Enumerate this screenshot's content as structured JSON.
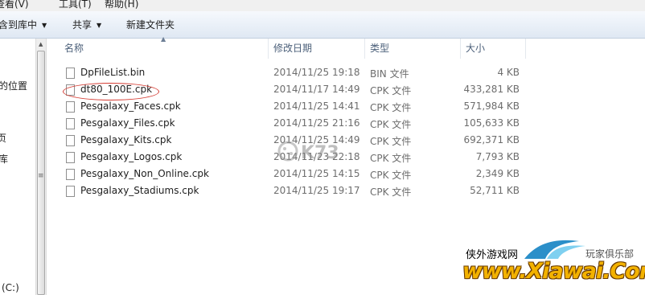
{
  "menu": [
    "查看(V)",
    "工具(T)",
    "帮助(H)"
  ],
  "toolbar": {
    "include_library": "含到库中",
    "share": "共享",
    "new_folder": "新建文件夹"
  },
  "nav": {
    "items": [
      "的位置",
      "页",
      "库"
    ],
    "drive": "(C:)"
  },
  "columns": {
    "name": "名称",
    "date": "修改日期",
    "type": "类型",
    "size": "大小"
  },
  "files": [
    {
      "name": "DpFileList.bin",
      "date": "2014/11/25 19:18",
      "type": "BIN 文件",
      "size": "4 KB"
    },
    {
      "name": "dt80_100E.cpk",
      "date": "2014/11/17 14:49",
      "type": "CPK 文件",
      "size": "433,281 KB"
    },
    {
      "name": "Pesgalaxy_Faces.cpk",
      "date": "2014/11/25 14:41",
      "type": "CPK 文件",
      "size": "571,984 KB"
    },
    {
      "name": "Pesgalaxy_Files.cpk",
      "date": "2014/11/25 21:16",
      "type": "CPK 文件",
      "size": "105,633 KB"
    },
    {
      "name": "Pesgalaxy_Kits.cpk",
      "date": "2014/11/25 14:49",
      "type": "CPK 文件",
      "size": "692,371 KB"
    },
    {
      "name": "Pesgalaxy_Logos.cpk",
      "date": "2014/11/23 22:18",
      "type": "CPK 文件",
      "size": "7,793 KB"
    },
    {
      "name": "Pesgalaxy_Non_Online.cpk",
      "date": "2014/11/25 14:15",
      "type": "CPK 文件",
      "size": "2,349 KB"
    },
    {
      "name": "Pesgalaxy_Stadiums.cpk",
      "date": "2014/11/25 19:17",
      "type": "CPK 文件",
      "size": "52,711 KB"
    }
  ],
  "watermark": {
    "site_cn": "侠外游戏网",
    "club": "玩家俱乐部",
    "brand": "www.Xiawai.Com",
    "k73": "K73"
  },
  "colors": {
    "highlight_circle": "#d43b32",
    "brand_gold": "#f3b200"
  }
}
